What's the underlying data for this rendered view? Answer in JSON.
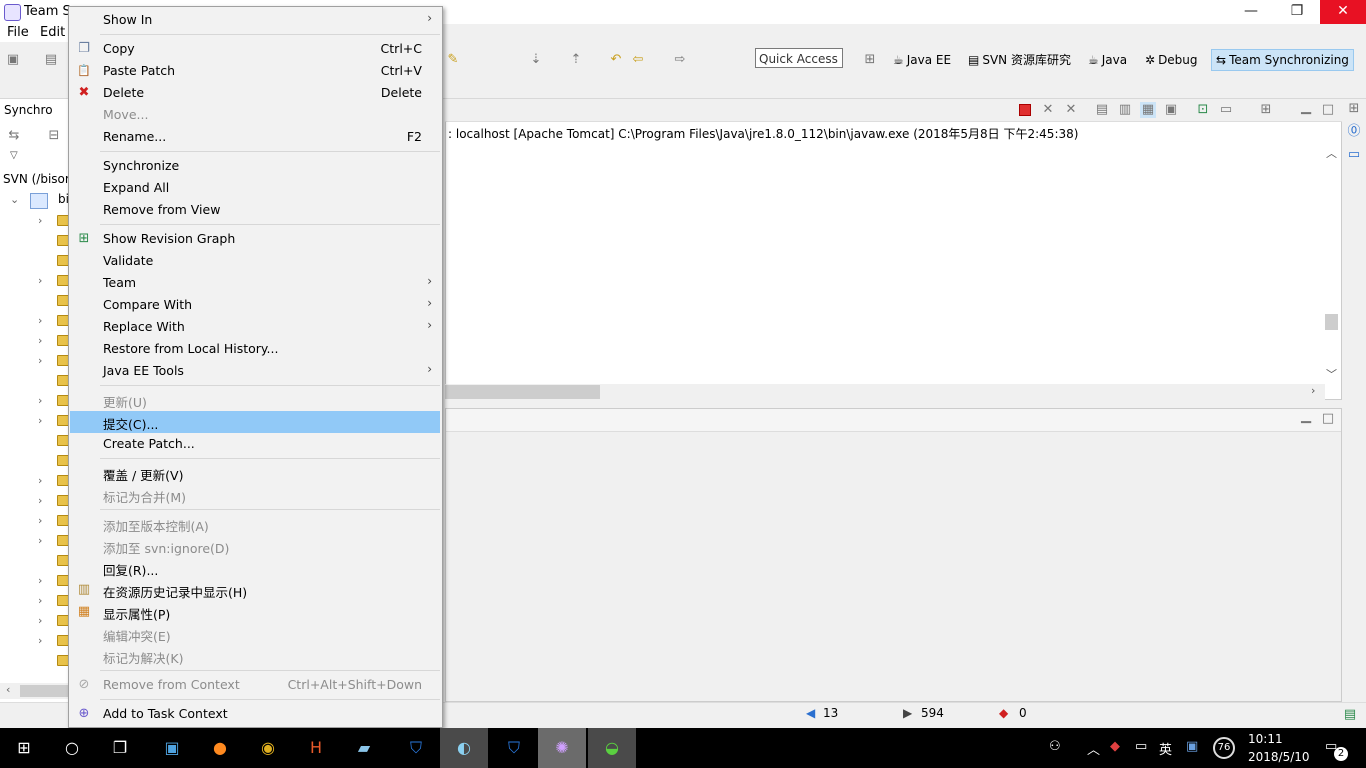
{
  "window": {
    "title": "Team Sy",
    "app_icon": "eclipse-icon",
    "controls": {
      "minimize": "—",
      "maximize": "❐",
      "close": "✕"
    }
  },
  "menubar": {
    "file": "File",
    "edit": "Edit"
  },
  "toolbar": {
    "quick_access_placeholder": "Quick Access",
    "perspectives": [
      {
        "label": "Java EE",
        "icon": "javaee-icon",
        "glyph": "☕"
      },
      {
        "label": "SVN 资源库研究",
        "icon": "svn-icon",
        "glyph": "▤"
      },
      {
        "label": "Java",
        "icon": "java-icon",
        "glyph": "☕"
      },
      {
        "label": "Debug",
        "icon": "debug-icon",
        "glyph": "✲"
      },
      {
        "label": "Team Synchronizing",
        "icon": "team-sync-icon",
        "glyph": "⇆"
      }
    ]
  },
  "left_panel": {
    "tab_label": "Synchro",
    "tree_root_label": "SVN (/bisor",
    "project_label": "bi"
  },
  "console": {
    "text": ": localhost [Apache Tomcat] C:\\Program Files\\Java\\jre1.8.0_112\\bin\\javaw.exe (2018年5月8日 下午2:45:38)"
  },
  "status": {
    "incoming": "13",
    "outgoing": "594",
    "conflicts": "0"
  },
  "context_menu": {
    "items": [
      {
        "label": "Show In",
        "submenu": true
      },
      {
        "label": "Copy",
        "shortcut": "Ctrl+C",
        "icon": "copy-icon",
        "glyph": "❐"
      },
      {
        "label": "Paste Patch",
        "shortcut": "Ctrl+V",
        "icon": "paste-icon",
        "glyph": "📋"
      },
      {
        "label": "Delete",
        "shortcut": "Delete",
        "icon": "delete-icon",
        "glyph": "✖"
      },
      {
        "label": "Move...",
        "disabled": true
      },
      {
        "label": "Rename...",
        "shortcut": "F2"
      },
      {
        "label": "Synchronize"
      },
      {
        "label": "Expand All"
      },
      {
        "label": "Remove from View"
      },
      {
        "label": "Show Revision Graph",
        "icon": "revision-graph-icon",
        "glyph": "⊞"
      },
      {
        "label": "Validate"
      },
      {
        "label": "Team",
        "submenu": true
      },
      {
        "label": "Compare With",
        "submenu": true
      },
      {
        "label": "Replace With",
        "submenu": true
      },
      {
        "label": "Restore from Local History..."
      },
      {
        "label": "Java EE Tools",
        "submenu": true
      },
      {
        "label": "更新(U)",
        "disabled": true
      },
      {
        "label": "提交(C)...",
        "selected": true
      },
      {
        "label": "Create Patch..."
      },
      {
        "label": "覆盖 / 更新(V)"
      },
      {
        "label": "标记为合并(M)",
        "disabled": true
      },
      {
        "label": "添加至版本控制(A)",
        "disabled": true
      },
      {
        "label": "添加至 svn:ignore(D)",
        "disabled": true
      },
      {
        "label": "回复(R)..."
      },
      {
        "label": "在资源历史记录中显示(H)",
        "icon": "history-icon",
        "glyph": "▥"
      },
      {
        "label": "显示属性(P)",
        "icon": "properties-icon",
        "glyph": "▦"
      },
      {
        "label": "编辑冲突(E)",
        "disabled": true
      },
      {
        "label": "标记为解决(K)",
        "disabled": true
      },
      {
        "label": "Remove from Context",
        "shortcut": "Ctrl+Alt+Shift+Down",
        "disabled": true,
        "icon": "remove-context-icon",
        "glyph": "⊘"
      },
      {
        "label": "Add to Task Context",
        "icon": "task-context-icon",
        "glyph": "⊕"
      }
    ]
  },
  "taskbar": {
    "clock_time": "10:11",
    "clock_date": "2018/5/10",
    "ime": "英",
    "battery": "76",
    "notifications": "2"
  },
  "colors": {
    "selection": "#91c9f7",
    "close_button": "#e81123",
    "taskbar": "#000000",
    "active_perspective": "#cce4f7"
  }
}
